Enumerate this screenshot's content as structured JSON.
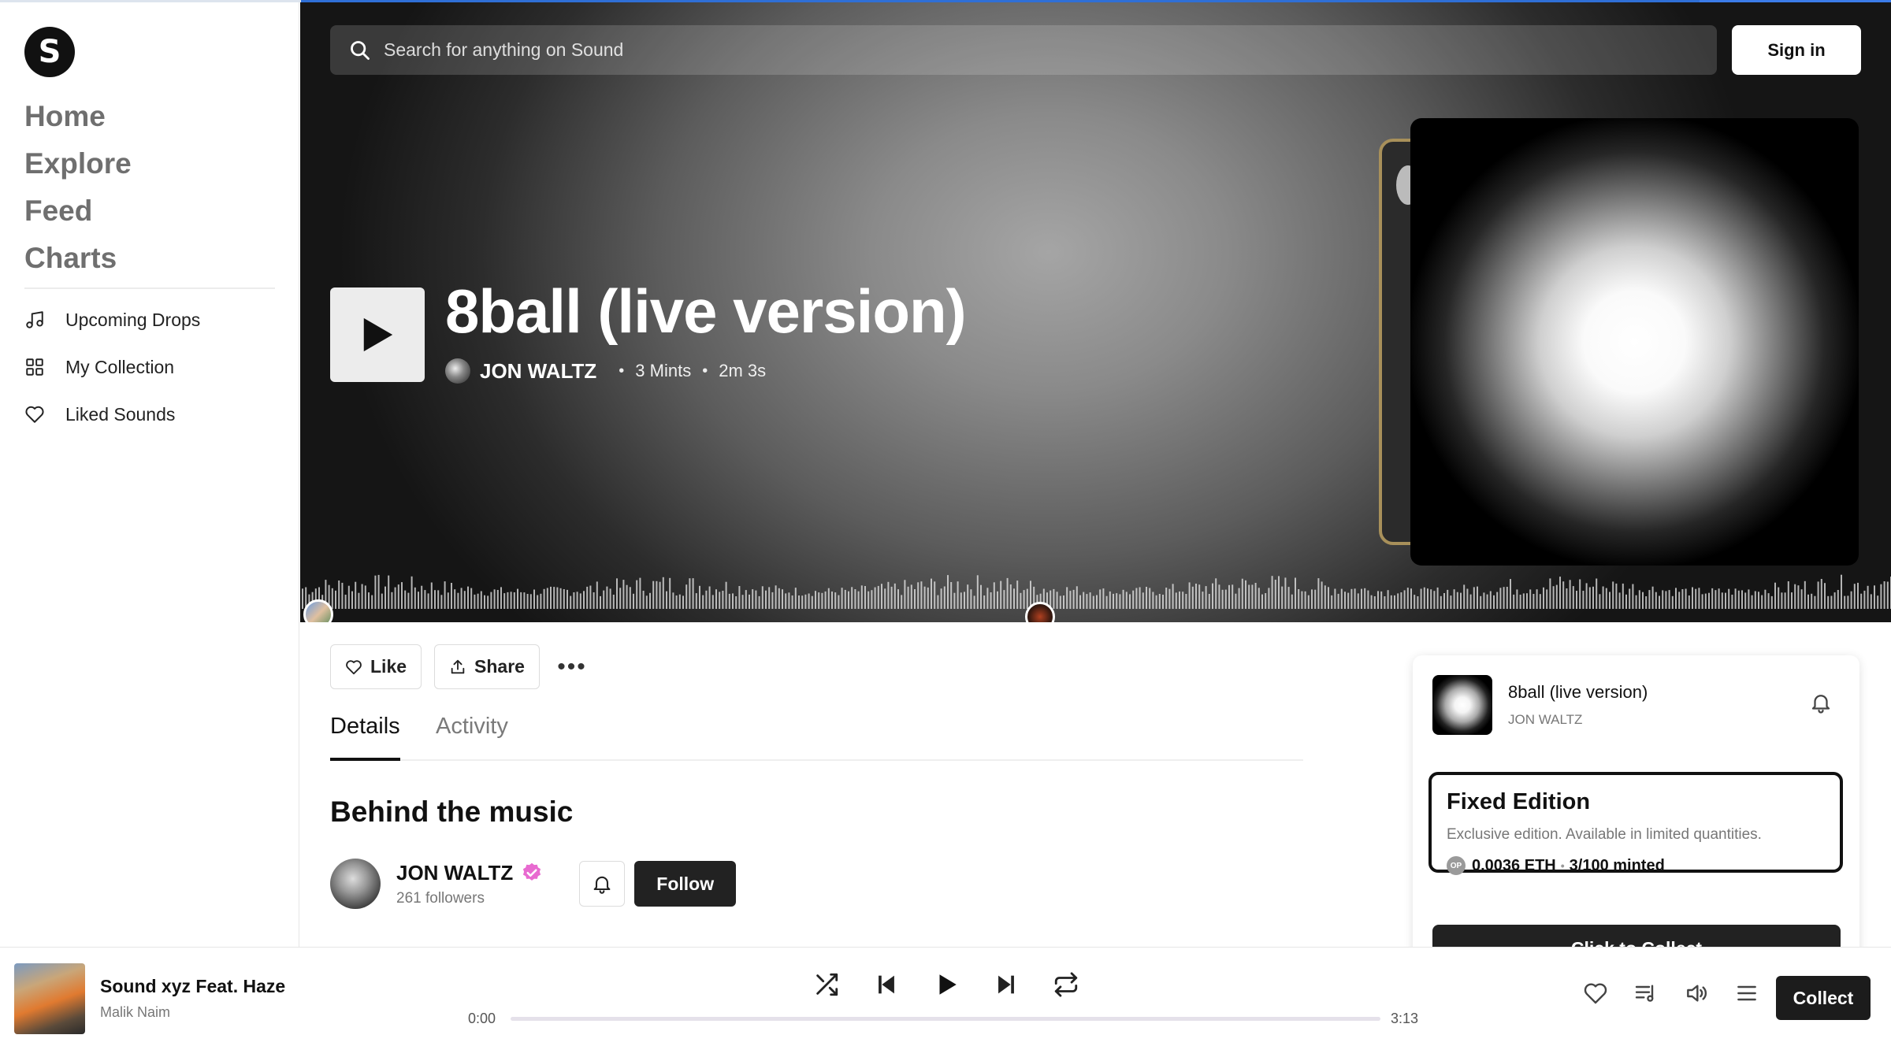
{
  "logo": {
    "letter": "S",
    "icon": "sound-logo-icon"
  },
  "nav": {
    "main": [
      {
        "label": "Home"
      },
      {
        "label": "Explore"
      },
      {
        "label": "Feed"
      },
      {
        "label": "Charts"
      }
    ],
    "secondary": [
      {
        "label": "Upcoming Drops",
        "icon": "music-note-icon"
      },
      {
        "label": "My Collection",
        "icon": "grid-icon"
      },
      {
        "label": "Liked Sounds",
        "icon": "heart-icon"
      }
    ]
  },
  "header": {
    "search_placeholder": "Search for anything on Sound",
    "signin_label": "Sign in"
  },
  "hero": {
    "title": "8ball (live version)",
    "artist": "JON WALTZ",
    "mints": "3 Mints",
    "duration": "2m 3s"
  },
  "actions": {
    "like": "Like",
    "share": "Share",
    "more": "•••"
  },
  "tabs": [
    {
      "label": "Details",
      "active": true
    },
    {
      "label": "Activity",
      "active": false
    }
  ],
  "details": {
    "heading": "Behind the music",
    "artist_name": "JON WALTZ",
    "followers": "261 followers",
    "follow_label": "Follow"
  },
  "mint_card": {
    "title": "8ball (live version)",
    "artist": "JON WALTZ",
    "edition_title": "Fixed Edition",
    "edition_desc": "Exclusive edition. Available in limited quantities.",
    "op_badge": "OP",
    "price": "0.0036 ETH",
    "minted": "3/100 minted",
    "cta": "Click to Collect"
  },
  "player": {
    "track_title": "Sound xyz Feat. Haze",
    "track_artist": "Malik Naim",
    "time_current": "0:00",
    "time_total": "3:13",
    "progress": 0,
    "collect_label": "Collect"
  },
  "colors": {
    "accent_blue": "#2f6fd6",
    "verified": "#e86ad0",
    "dark_button": "#222222"
  }
}
